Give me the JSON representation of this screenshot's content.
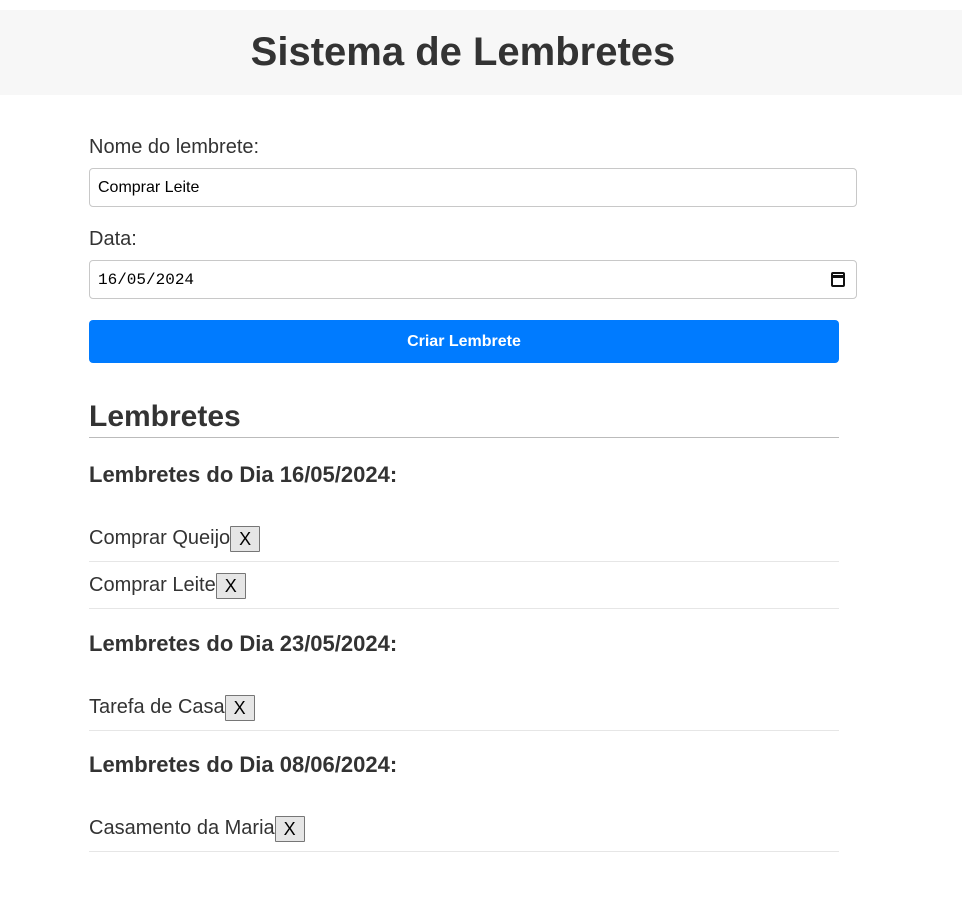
{
  "header": {
    "title": "Sistema de Lembretes"
  },
  "form": {
    "name_label": "Nome do lembrete:",
    "name_value": "Comprar Leite",
    "date_label": "Data:",
    "date_value": "16/05/2024",
    "submit_label": "Criar Lembrete"
  },
  "list": {
    "title": "Lembretes",
    "groups": [
      {
        "heading": "Lembretes do Dia 16/05/2024:",
        "items": [
          {
            "name": "Comprar Queijo",
            "remove_label": "X"
          },
          {
            "name": "Comprar Leite",
            "remove_label": "X"
          }
        ]
      },
      {
        "heading": "Lembretes do Dia 23/05/2024:",
        "items": [
          {
            "name": "Tarefa de Casa",
            "remove_label": "X"
          }
        ]
      },
      {
        "heading": "Lembretes do Dia 08/06/2024:",
        "items": [
          {
            "name": "Casamento da Maria",
            "remove_label": "X"
          }
        ]
      }
    ]
  },
  "colors": {
    "header_background": "#f7f7f7",
    "button_primary": "#007bff",
    "text": "#333333"
  },
  "icons": {
    "date_picker": "calendar-icon"
  }
}
